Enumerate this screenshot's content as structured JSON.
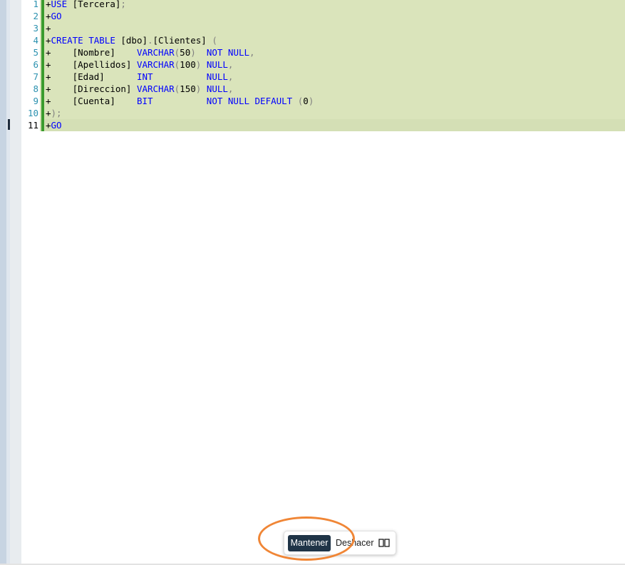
{
  "editor": {
    "lines": [
      {
        "num": "1",
        "marker": "+",
        "parts": [
          [
            "kw",
            "USE"
          ],
          [
            "txt",
            " [Tercera]"
          ],
          [
            "gray",
            ";"
          ]
        ]
      },
      {
        "num": "2",
        "marker": "+",
        "parts": [
          [
            "kw",
            "GO"
          ]
        ]
      },
      {
        "num": "3",
        "marker": "+",
        "parts": []
      },
      {
        "num": "4",
        "marker": "+",
        "parts": [
          [
            "kw",
            "CREATE TABLE"
          ],
          [
            "txt",
            " [dbo]"
          ],
          [
            "gray",
            "."
          ],
          [
            "txt",
            "[Clientes]"
          ],
          [
            "gray",
            " ("
          ]
        ]
      },
      {
        "num": "5",
        "marker": "+",
        "parts": [
          [
            "txt",
            "    [Nombre]    "
          ],
          [
            "kw",
            "VARCHAR"
          ],
          [
            "gray",
            "("
          ],
          [
            "txt",
            "50"
          ],
          [
            "gray",
            ")"
          ],
          [
            "txt",
            "  "
          ],
          [
            "kw",
            "NOT NULL"
          ],
          [
            "gray",
            ","
          ]
        ]
      },
      {
        "num": "6",
        "marker": "+",
        "parts": [
          [
            "txt",
            "    [Apellidos] "
          ],
          [
            "kw",
            "VARCHAR"
          ],
          [
            "gray",
            "("
          ],
          [
            "txt",
            "100"
          ],
          [
            "gray",
            ")"
          ],
          [
            "txt",
            " "
          ],
          [
            "kw",
            "NULL"
          ],
          [
            "gray",
            ","
          ]
        ]
      },
      {
        "num": "7",
        "marker": "+",
        "parts": [
          [
            "txt",
            "    [Edad]      "
          ],
          [
            "kw",
            "INT"
          ],
          [
            "txt",
            "          "
          ],
          [
            "kw",
            "NULL"
          ],
          [
            "gray",
            ","
          ]
        ]
      },
      {
        "num": "8",
        "marker": "+",
        "parts": [
          [
            "txt",
            "    [Direccion] "
          ],
          [
            "kw",
            "VARCHAR"
          ],
          [
            "gray",
            "("
          ],
          [
            "txt",
            "150"
          ],
          [
            "gray",
            ")"
          ],
          [
            "txt",
            " "
          ],
          [
            "kw",
            "NULL"
          ],
          [
            "gray",
            ","
          ]
        ]
      },
      {
        "num": "9",
        "marker": "+",
        "parts": [
          [
            "txt",
            "    [Cuenta]    "
          ],
          [
            "kw",
            "BIT"
          ],
          [
            "txt",
            "          "
          ],
          [
            "kw",
            "NOT NULL DEFAULT"
          ],
          [
            "txt",
            " "
          ],
          [
            "gray",
            "("
          ],
          [
            "txt",
            "0"
          ],
          [
            "gray",
            ")"
          ]
        ]
      },
      {
        "num": "10",
        "marker": "+",
        "parts": [
          [
            "gray",
            ");"
          ]
        ]
      },
      {
        "num": "11",
        "marker": "+",
        "parts": [
          [
            "kw",
            "GO"
          ]
        ],
        "active": true
      }
    ]
  },
  "actions": {
    "keep_label": "Mantener",
    "undo_label": "Deshacer",
    "compare_icon": "compare-icon"
  },
  "colors": {
    "added_bg": "#dae4bb",
    "added_bar": "#3b9c2e",
    "keyword": "#0000ff",
    "line_number": "#2b91af",
    "highlight_ring": "#f08636"
  }
}
